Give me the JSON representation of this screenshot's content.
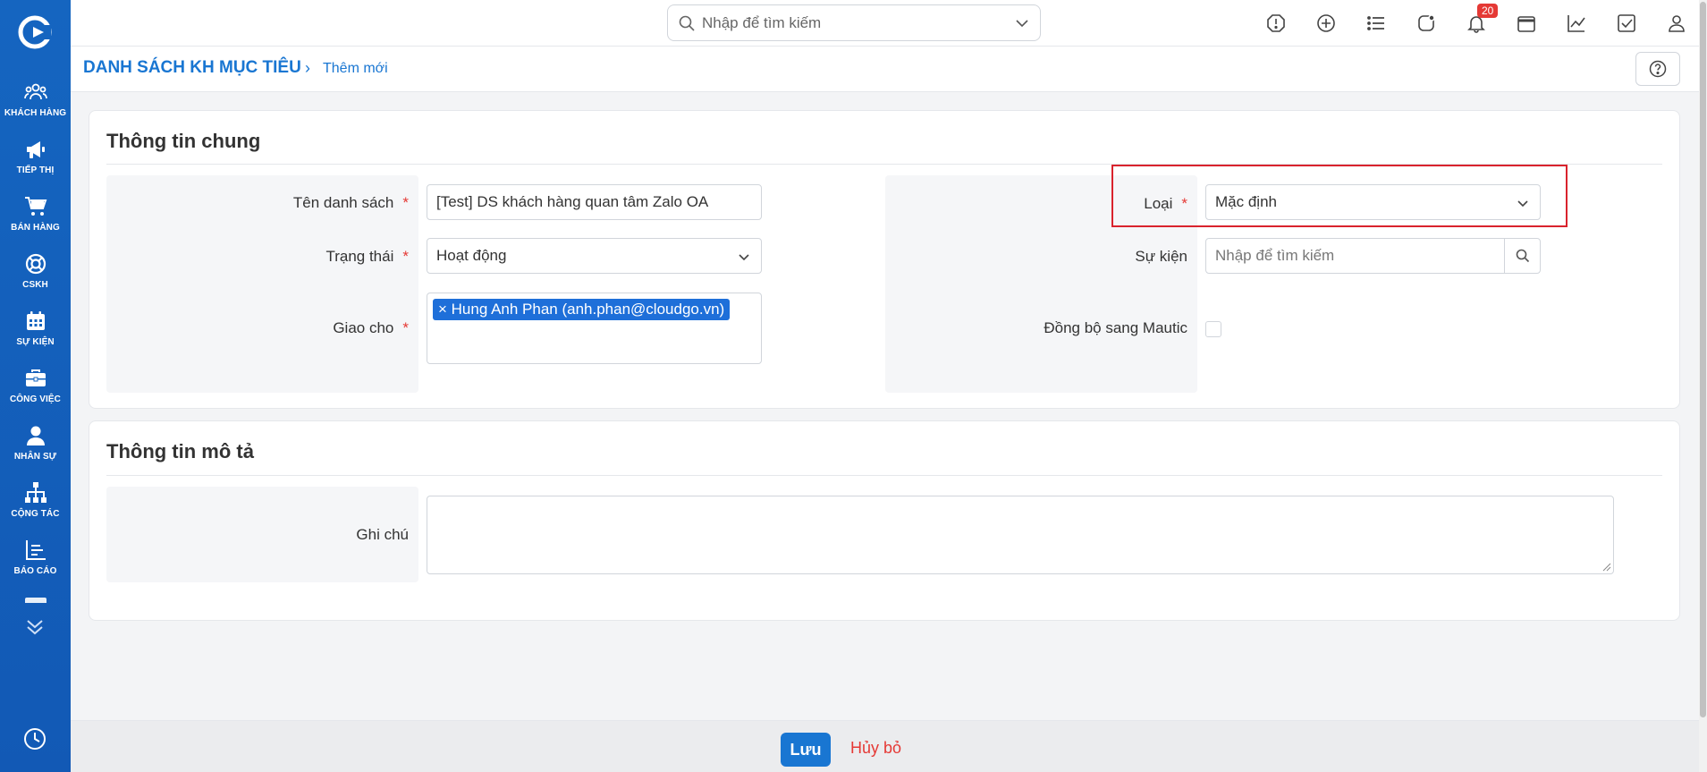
{
  "sidebar": {
    "items": [
      {
        "label": "KHÁCH HÀNG",
        "icon": "customers-icon"
      },
      {
        "label": "TIẾP THỊ",
        "icon": "megaphone-icon"
      },
      {
        "label": "BÁN HÀNG",
        "icon": "cart-icon"
      },
      {
        "label": "CSKH",
        "icon": "lifebuoy-icon"
      },
      {
        "label": "SỰ KIỆN",
        "icon": "calendar-icon"
      },
      {
        "label": "CÔNG VIỆC",
        "icon": "briefcase-icon"
      },
      {
        "label": "NHÂN SỰ",
        "icon": "person-icon"
      },
      {
        "label": "CỘNG TÁC",
        "icon": "org-chart-icon"
      },
      {
        "label": "BÁO CÁO",
        "icon": "report-icon"
      }
    ]
  },
  "topbar": {
    "search_placeholder": "Nhập để tìm kiếm",
    "notification_count": "20"
  },
  "breadcrumb": {
    "main": "DANH SÁCH KH MỤC TIÊU",
    "separator": "›",
    "current": "Thêm mới"
  },
  "general": {
    "title": "Thông tin chung",
    "name_label": "Tên danh sách",
    "name_value": "[Test] DS khách hàng quan tâm Zalo OA",
    "status_label": "Trạng thái",
    "status_value": "Hoạt động",
    "assign_label": "Giao cho",
    "assign_tag": "× Hung Anh Phan (anh.phan@cloudgo.vn)",
    "type_label": "Loại",
    "type_value": "Mặc định",
    "event_label": "Sự kiện",
    "event_placeholder": "Nhập để tìm kiếm",
    "sync_label": "Đồng bộ sang Mautic",
    "required_mark": "*"
  },
  "description": {
    "title": "Thông tin mô tả",
    "note_label": "Ghi chú",
    "note_value": ""
  },
  "footer": {
    "save_label": "Lưu",
    "cancel_label": "Hủy bỏ"
  },
  "colors": {
    "sidebar": "#1565c0",
    "accent": "#1976d2",
    "danger": "#e53935"
  }
}
